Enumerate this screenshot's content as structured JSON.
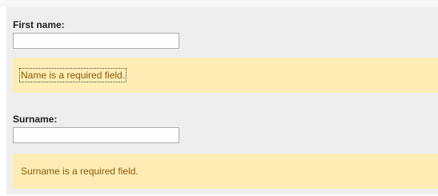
{
  "form": {
    "first_name": {
      "label": "First name:",
      "value": "",
      "error": "Name is a required field."
    },
    "surname": {
      "label": "Surname:",
      "value": "",
      "error": "Surname is a required field."
    }
  },
  "colors": {
    "panel_bg": "#eeeeee",
    "error_bg": "#fdedb5",
    "error_text": "#8a5a0a"
  }
}
